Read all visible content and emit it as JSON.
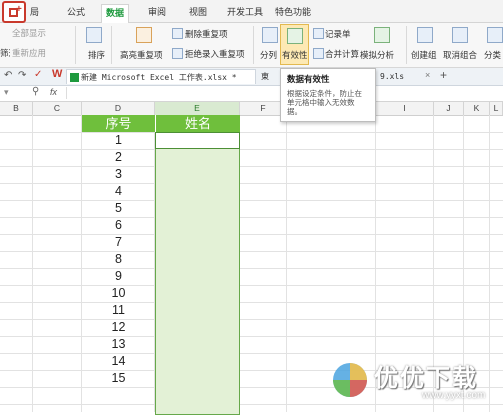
{
  "ribbon_tabs": [
    "局",
    "公式",
    "数据",
    "审阅",
    "视图",
    "开发工具",
    "特色功能"
  ],
  "ribbon": {
    "filter_show_all": "全部显示",
    "filter_reapply": "重新应用",
    "filter_label": "筛选",
    "sort": "排序",
    "highlight_dup": "高亮重复项",
    "remove_dup": "删除重复项",
    "reject_dup": "拒绝录入重复项",
    "split": "分列",
    "validity": "有效性",
    "record": "记录单",
    "merge_calc": "合并计算",
    "simulate": "模拟分析",
    "create_group": "创建组",
    "ungroup": "取消组合",
    "split_total": "分类"
  },
  "doc_tabs": {
    "active": "新建 Microsoft Excel 工作表.xlsx *",
    "second": "東",
    "third": "9.xls"
  },
  "formula_bar": {
    "fx": "fx"
  },
  "columns": [
    "B",
    "C",
    "D",
    "E",
    "F",
    "I",
    "J",
    "K",
    "L"
  ],
  "table": {
    "header_seq": "序号",
    "header_name": "姓名",
    "rows": [
      "1",
      "2",
      "3",
      "4",
      "5",
      "6",
      "7",
      "8",
      "9",
      "10",
      "11",
      "12",
      "13",
      "14",
      "15"
    ]
  },
  "tooltip": {
    "title": "数据有效性",
    "body": "根据设定条件，防止在单元格中输入无效数据。"
  },
  "watermark": {
    "text": "优优下载",
    "url": "www.yyxt.com"
  },
  "colors": {
    "accent": "#1e9a3e",
    "table_header": "#6fbf3c",
    "name_fill": "#e3f1d6"
  }
}
